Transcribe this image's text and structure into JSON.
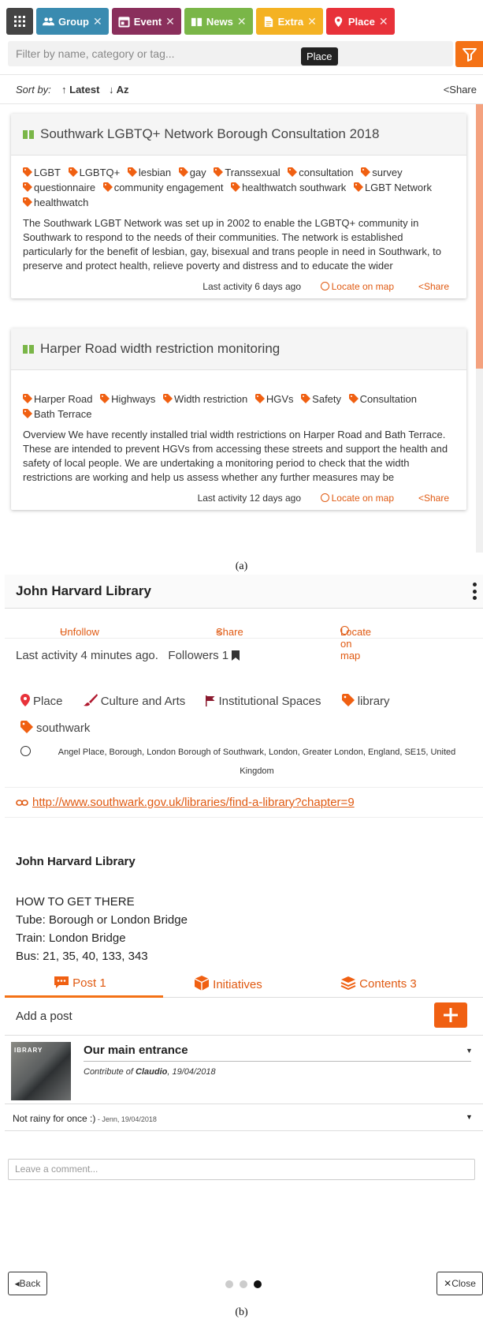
{
  "panel_a": {
    "caption": "(a)",
    "filters": [
      {
        "label": "Group",
        "color": "#3a8bb0",
        "icon": "group-icon"
      },
      {
        "label": "Event",
        "color": "#8a2f5c",
        "icon": "calendar-icon"
      },
      {
        "label": "News",
        "color": "#7ab648",
        "icon": "quote-icon"
      },
      {
        "label": "Extra",
        "color": "#f4b223",
        "icon": "document-icon"
      },
      {
        "label": "Place",
        "color": "#e8323a",
        "icon": "map-pin-icon"
      }
    ],
    "search": {
      "placeholder": "Filter by name, category or tag..."
    },
    "tooltip": "Place",
    "sort": {
      "label": "Sort by:",
      "latest": "Latest",
      "az": "Az",
      "share": "Share"
    },
    "cards": [
      {
        "title": "Southwark LGBTQ+ Network Borough Consultation 2018",
        "tags": [
          "LGBT",
          "LGBTQ+",
          "lesbian",
          "gay",
          "Transsexual",
          "consultation",
          "survey",
          "questionnaire",
          "community engagement",
          "healthwatch southwark",
          "LGBT Network",
          "healthwatch"
        ],
        "description": "The Southwark LGBT Network was set up in 2002 to enable the LGBTQ+ community in Southwark to respond to the needs of their communities. The network is established particularly for the benefit of lesbian, gay, bisexual and trans people in need in Southwark, to preserve and protect health, relieve poverty and distress and to educate the wider",
        "activity": "Last activity 6 days ago",
        "locate": "Locate on map",
        "share": "Share"
      },
      {
        "title": "Harper Road width restriction monitoring",
        "tags": [
          "Harper Road",
          "Highways",
          "Width restriction",
          "HGVs",
          "Safety",
          "Consultation",
          "Bath Terrace"
        ],
        "description": "Overview We have recently installed trial width restrictions on Harper Road and Bath Terrace. These are intended to prevent HGVs from accessing these streets and support the health and safety of local people. We are undertaking a monitoring period to check that the width restrictions are working and help us assess whether any further measures may be",
        "activity": "Last activity 12 days ago",
        "locate": "Locate on map",
        "share": "Share"
      }
    ]
  },
  "panel_b": {
    "caption": "(b)",
    "title": "John Harvard Library",
    "actions": {
      "unfollow": "Unfollow",
      "share": "Share",
      "locate": "Locate on map"
    },
    "meta": "Last activity 4 minutes ago.   Followers 1",
    "categories": [
      {
        "label": "Place",
        "icon": "map-pin-icon"
      },
      {
        "label": "Culture and Arts",
        "icon": "paintbrush-icon"
      },
      {
        "label": "Institutional Spaces",
        "icon": "flag-icon"
      },
      {
        "label": "library",
        "icon": "tag-icon"
      },
      {
        "label": "southwark",
        "icon": "tag-icon"
      }
    ],
    "address": "Angel Place, Borough, London Borough of Southwark, London, Greater London, England, SE15, United Kingdom",
    "link": "http://www.southwark.gov.uk/libraries/find-a-library?chapter=9",
    "body": {
      "heading": "John Harvard Library",
      "lines": [
        "HOW TO GET THERE",
        "Tube: Borough or London Bridge",
        "Train: London Bridge",
        "Bus: 21, 35, 40, 133, 343"
      ]
    },
    "tabs": {
      "post": "Post 1",
      "initiatives": "Initiatives",
      "contents": "Contents 3"
    },
    "add_post": "Add a post",
    "post": {
      "title": "Our main entrance",
      "contrib_prefix": "Contribute of",
      "author": "Claudio",
      "date": ", 19/04/2018",
      "thumb_text": "IBRARY"
    },
    "comment": {
      "text": "Not rainy for once :)",
      "meta": " - Jenn, 19/04/2018"
    },
    "comment_placeholder": "Leave a comment...",
    "back": "Back",
    "close": "Close"
  },
  "colors": {
    "accent": "#f47216",
    "link": "#e05a12"
  }
}
